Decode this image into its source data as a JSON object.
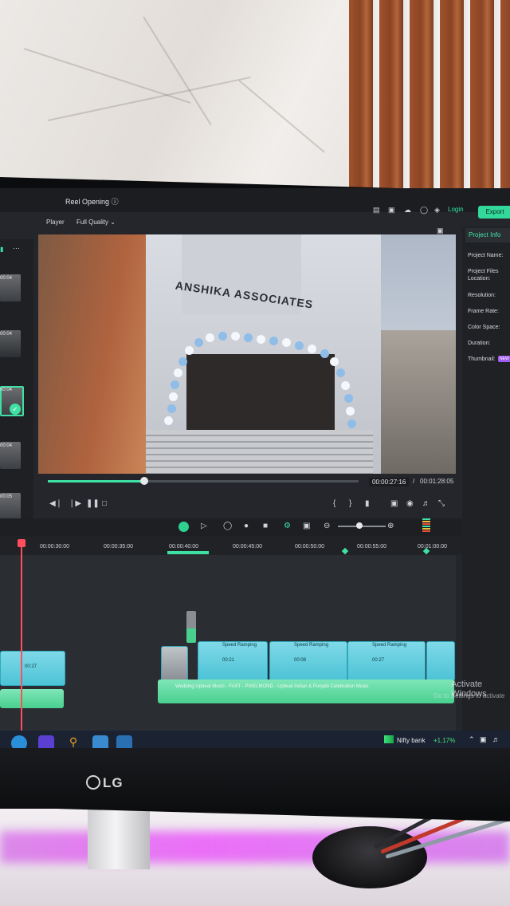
{
  "app": {
    "project_title": "Reel Opening",
    "login_label": "Login",
    "export_label": "Export"
  },
  "player": {
    "label": "Player",
    "quality": "Full Quality",
    "sign_text": "ANSHIKA ASSOCIATES",
    "time_current": "00:00:27:16",
    "time_separator": "/",
    "time_total": "00:01:28:05",
    "progress": 0.31
  },
  "media": {
    "items": [
      {
        "duration": "00:04"
      },
      {
        "duration": "00:04"
      },
      {
        "duration": "00:04"
      },
      {
        "duration": "00:04"
      },
      {
        "duration": "00:05"
      }
    ]
  },
  "info_panel": {
    "tab": "Project Info",
    "fields": [
      "Project Name:",
      "Project Files Location:",
      "Resolution:",
      "Frame Rate:",
      "Color Space:",
      "Duration:",
      "Thumbnail:"
    ],
    "thumbnail_badge": "NEW"
  },
  "timeline": {
    "ruler": [
      "00:00:30:00",
      "00:00:35:00",
      "00:00:40:00",
      "00:00:45:00",
      "00:00:50:00",
      "00:00:55:00",
      "00:01:00:00"
    ],
    "clips": [
      {
        "label": "Speed Ramping",
        "thumb": "00:21"
      },
      {
        "label": "Speed Ramping",
        "thumb": "00:08"
      },
      {
        "label": "Speed Ramping",
        "thumb": "00:27"
      }
    ],
    "left_clip_thumb": "00:27",
    "audio_label": "Wedding Upbeat Music - FAST - PIXELMOND - Upbeat Indian & Punjabi Celebration Music",
    "watermark_line1": "Activate Windows",
    "watermark_line2": "Go to Settings to activate"
  },
  "taskbar": {
    "ticker_name": "Nifty bank",
    "ticker_change": "+1.17%"
  },
  "monitor": {
    "brand": "LG"
  },
  "colors": {
    "accent": "#33d99a",
    "playhead": "#ff4f5e",
    "clip": "#4cc3d6"
  }
}
